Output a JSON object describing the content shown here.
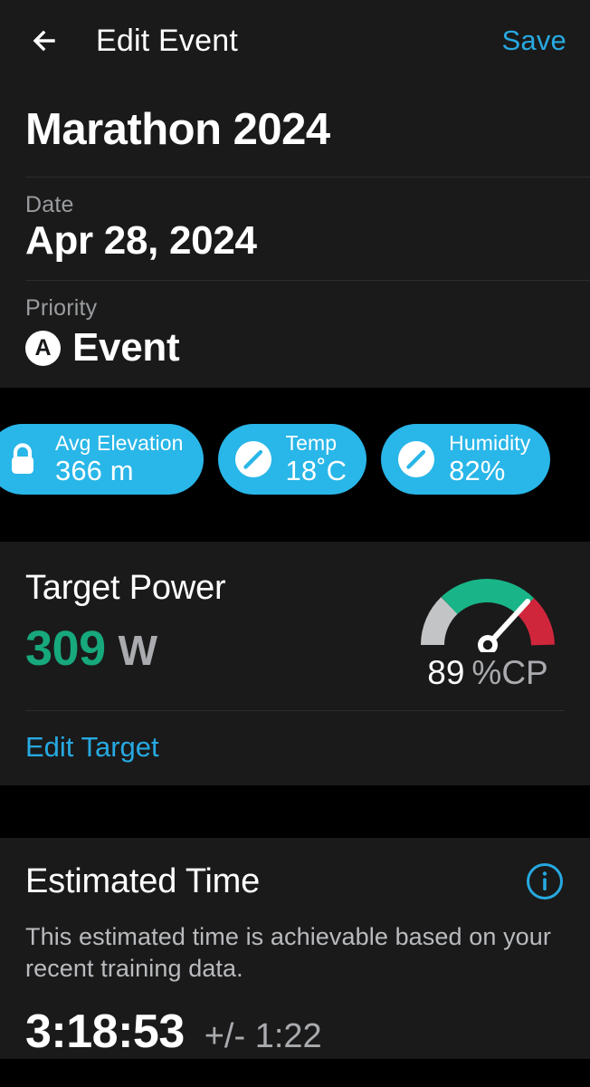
{
  "header": {
    "back_icon": "arrow-left-icon",
    "title": "Edit Event",
    "save_label": "Save"
  },
  "event": {
    "name": "Marathon 2024",
    "date_label": "Date",
    "date_value": "Apr 28, 2024",
    "priority_label": "Priority",
    "priority_badge": "A",
    "priority_value": "Event"
  },
  "chips": [
    {
      "icon": "lock-icon",
      "label": "Avg Elevation",
      "value": "366 m"
    },
    {
      "icon": "pencil-icon",
      "label": "Temp",
      "value": "18˚C"
    },
    {
      "icon": "pencil-icon",
      "label": "Humidity",
      "value": "82%"
    }
  ],
  "target_power": {
    "title": "Target Power",
    "value": "309",
    "unit": "W",
    "gauge_value": "89",
    "gauge_unit": "%CP",
    "edit_label": "Edit Target"
  },
  "estimated_time": {
    "title": "Estimated Time",
    "info_icon": "info-icon",
    "description": "This estimated time is achievable based on your recent training data.",
    "time": "3:18:53",
    "range": "+/- 1:22"
  },
  "colors": {
    "accent_blue": "#27a9e1",
    "chip_blue": "#29b6e8",
    "green": "#17a87c",
    "gauge_green": "#19b588",
    "gauge_gray": "#c2c4c6",
    "gauge_red": "#d0263c",
    "card_bg": "#1a1a1a",
    "page_bg": "#000000"
  }
}
